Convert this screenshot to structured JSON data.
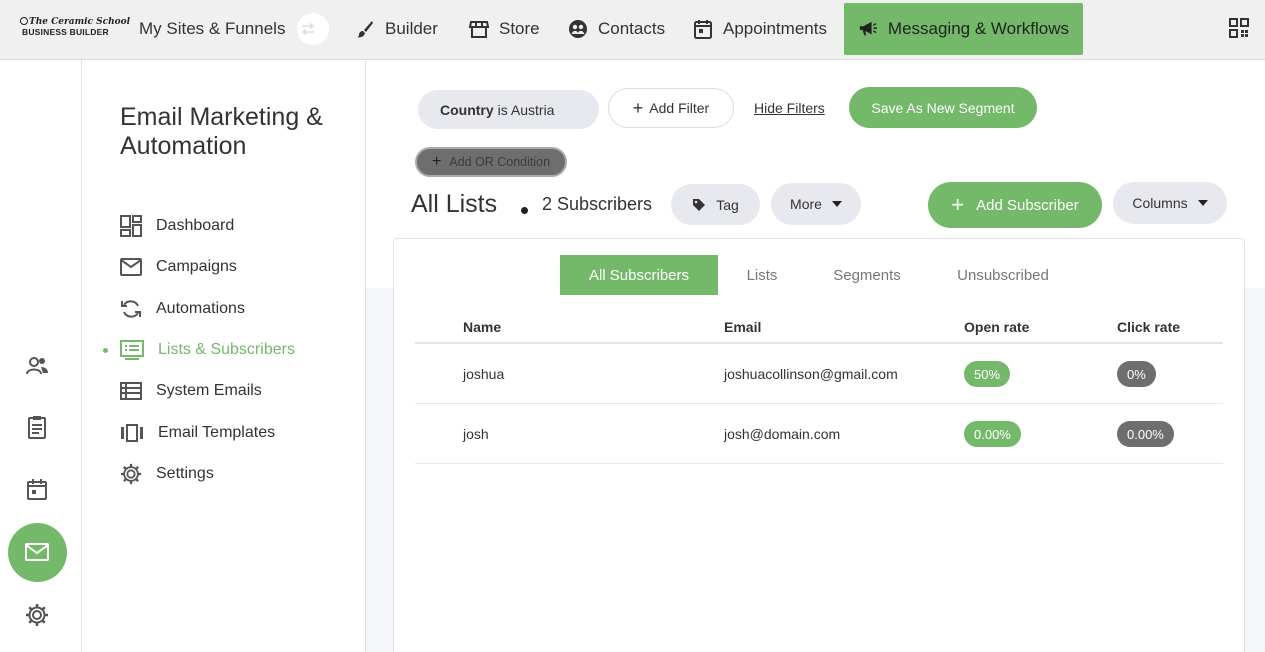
{
  "brand": {
    "logo_line1": "The Ceramic School",
    "logo_line2": "BUSINESS BUILDER"
  },
  "topnav": {
    "sites": "My Sites & Funnels",
    "builder": "Builder",
    "store": "Store",
    "contacts": "Contacts",
    "appointments": "Appointments",
    "messaging": "Messaging & Workflows"
  },
  "sidebar": {
    "title": "Email Marketing & Automation",
    "items": [
      {
        "label": "Dashboard"
      },
      {
        "label": "Campaigns"
      },
      {
        "label": "Automations"
      },
      {
        "label": "Lists & Subscribers"
      },
      {
        "label": "System Emails"
      },
      {
        "label": "Email Templates"
      },
      {
        "label": "Settings"
      }
    ]
  },
  "filters": {
    "field": "Country",
    "operator_value": "is Austria",
    "add_filter": "Add Filter",
    "hide_filters": "Hide Filters",
    "save_segment": "Save As New Segment",
    "add_or": "Add OR Condition"
  },
  "list_header": {
    "title": "All Lists",
    "count": "2 Subscribers",
    "tag": "Tag",
    "more": "More",
    "add_subscriber": "Add Subscriber",
    "columns": "Columns"
  },
  "tabs": [
    "All Subscribers",
    "Lists",
    "Segments",
    "Unsubscribed"
  ],
  "table": {
    "headers": [
      "Name",
      "Email",
      "Open rate",
      "Click rate"
    ],
    "rows": [
      {
        "name": "joshua",
        "email": "joshuacollinson@gmail.com",
        "open": "50%",
        "click": "0%"
      },
      {
        "name": "josh",
        "email": "josh@domain.com",
        "open": "0.00%",
        "click": "0.00%"
      }
    ]
  },
  "colors": {
    "accent": "#74b96a",
    "pill_bg": "#e8e9ee",
    "dark_badge": "#6e6e6e"
  }
}
